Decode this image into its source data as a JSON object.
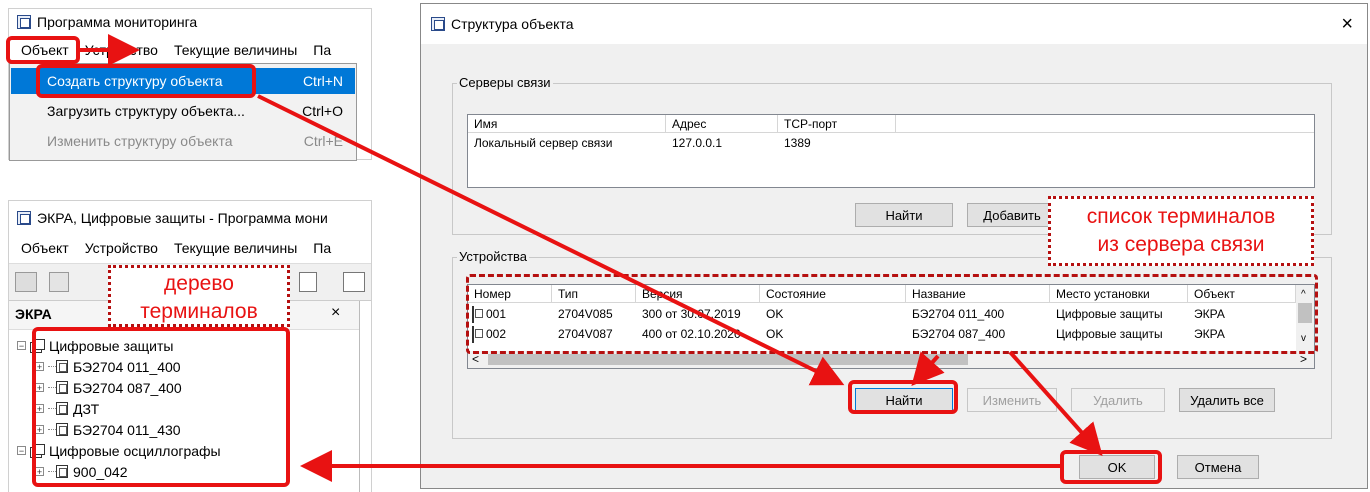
{
  "menu_window": {
    "title": "Программа мониторинга",
    "menubar": [
      "Объект",
      "Устройство",
      "Текущие величины",
      "Па"
    ],
    "items": [
      {
        "label": "Создать структуру объекта",
        "shortcut": "Ctrl+N"
      },
      {
        "label": "Загрузить структуру объекта...",
        "shortcut": "Ctrl+O"
      },
      {
        "label": "Изменить структуру объекта",
        "shortcut": "Ctrl+E"
      }
    ]
  },
  "tree_window": {
    "title": "ЭКРА, Цифровые защиты - Программа мони",
    "menubar": [
      "Объект",
      "Устройство",
      "Текущие величины",
      "Па"
    ],
    "panel_title": "ЭКРА",
    "close": "×",
    "tree": {
      "group1": "Цифровые защиты",
      "group1_items": [
        "БЭ2704 011_400",
        "БЭ2704 087_400",
        "ДЗТ",
        "БЭ2704 011_430"
      ],
      "group2": "Цифровые осциллографы",
      "group2_items": [
        "900_042"
      ]
    }
  },
  "dialog": {
    "title": "Структура объекта",
    "close": "×",
    "servers": {
      "label": "Серверы связи",
      "columns": [
        "Имя",
        "Адрес",
        "TCP-порт"
      ],
      "rows": [
        [
          "Локальный сервер связи",
          "127.0.0.1",
          "1389"
        ]
      ],
      "buttons": {
        "find": "Найти",
        "add": "Добавить"
      }
    },
    "devices": {
      "label": "Устройства",
      "columns": [
        "Номер",
        "Тип",
        "Версия",
        "Состояние",
        "Название",
        "Место установки",
        "Объект"
      ],
      "rows": [
        [
          "001",
          "2704V085",
          "300 от 30.07.2019",
          "OK",
          "БЭ2704 011_400",
          "Цифровые защиты",
          "ЭКРА"
        ],
        [
          "002",
          "2704V087",
          "400 от 02.10.2020",
          "OK",
          "БЭ2704 087_400",
          "Цифровые защиты",
          "ЭКРА"
        ]
      ],
      "buttons": {
        "find": "Найти",
        "edit": "Изменить",
        "delete": "Удалить",
        "delete_all": "Удалить все"
      }
    },
    "ok": "OK",
    "cancel": "Отмена"
  },
  "annotations": {
    "tree_callout": [
      "дерево",
      "терминалов"
    ],
    "list_callout": [
      "список терминалов",
      "из сервера связи"
    ]
  },
  "colors": {
    "accent": "#e81212",
    "selection": "#0078d7"
  }
}
